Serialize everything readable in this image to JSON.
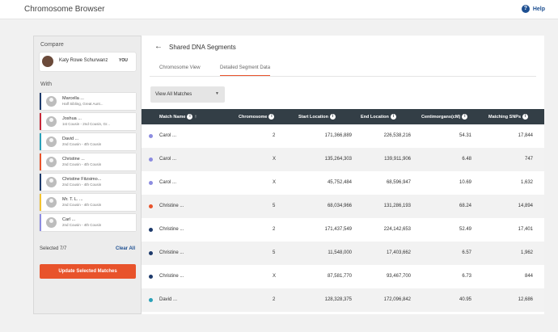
{
  "app": {
    "title": "Chromosome Browser",
    "help_label": "Help"
  },
  "sidebar": {
    "compare_heading": "Compare",
    "you": {
      "name": "Katy Rowe Schurwanz",
      "tag": "YOU"
    },
    "with_heading": "With",
    "matches": [
      {
        "name": "Marcella ...",
        "relationship": "Half Sibling, Great Aunt...",
        "color": "#1d3a6b"
      },
      {
        "name": "Joshua ...",
        "relationship": "1st Cousin - 2nd Cousin, Gr...",
        "color": "#c62839"
      },
      {
        "name": "David ...",
        "relationship": "2nd Cousin - 4th Cousin",
        "color": "#2aa0b8"
      },
      {
        "name": "Christine ...",
        "relationship": "2nd Cousin - 4th Cousin",
        "color": "#e8532b"
      },
      {
        "name": "Christine Fitzsimo...",
        "relationship": "2nd Cousin - 4th Cousin",
        "color": "#1d3a6b"
      },
      {
        "name": "Mr. T. L. ...",
        "relationship": "2nd Cousin - 4th Cousin",
        "color": "#f2c230"
      },
      {
        "name": "Carl ...",
        "relationship": "2nd Cousin - 4th Cousin",
        "color": "#8c8ce0"
      }
    ],
    "selected_label": "Selected 7/7",
    "clear_all": "Clear All",
    "update_button": "Update Selected Matches"
  },
  "main": {
    "title": "Shared DNA Segments",
    "tabs": [
      {
        "label": "Chromosome View"
      },
      {
        "label": "Detailed Segment Data"
      }
    ],
    "filter": {
      "label": "View All Matches",
      "caret": "▼"
    },
    "columns": {
      "match_name": "Match Name",
      "chromosome": "Chromosome",
      "start": "Start Location",
      "end": "End Location",
      "cm": "Centimorgans(cM)",
      "snps": "Matching SNPs"
    },
    "rows": [
      {
        "name": "Carol ...",
        "chromosome": "2",
        "start": "171,366,889",
        "end": "226,538,216",
        "cm": "54.31",
        "snps": "17,844",
        "color": "#8c8ce0"
      },
      {
        "name": "Carol ...",
        "chromosome": "X",
        "start": "135,264,303",
        "end": "139,911,906",
        "cm": "6.48",
        "snps": "747",
        "color": "#8c8ce0"
      },
      {
        "name": "Carol ...",
        "chromosome": "X",
        "start": "45,752,484",
        "end": "68,596,947",
        "cm": "10.69",
        "snps": "1,632",
        "color": "#8c8ce0"
      },
      {
        "name": "Christine ...",
        "chromosome": "5",
        "start": "68,034,966",
        "end": "131,286,193",
        "cm": "68.24",
        "snps": "14,894",
        "color": "#e8532b"
      },
      {
        "name": "Christine ...",
        "chromosome": "2",
        "start": "171,437,549",
        "end": "224,142,653",
        "cm": "52.49",
        "snps": "17,401",
        "color": "#1d3a6b"
      },
      {
        "name": "Christine ...",
        "chromosome": "5",
        "start": "11,548,000",
        "end": "17,403,662",
        "cm": "6.57",
        "snps": "1,962",
        "color": "#1d3a6b"
      },
      {
        "name": "Christine ...",
        "chromosome": "X",
        "start": "87,581,770",
        "end": "93,467,700",
        "cm": "6.73",
        "snps": "844",
        "color": "#1d3a6b"
      },
      {
        "name": "David ...",
        "chromosome": "2",
        "start": "128,328,375",
        "end": "172,096,842",
        "cm": "40.95",
        "snps": "12,686",
        "color": "#2aa0b8"
      }
    ]
  }
}
